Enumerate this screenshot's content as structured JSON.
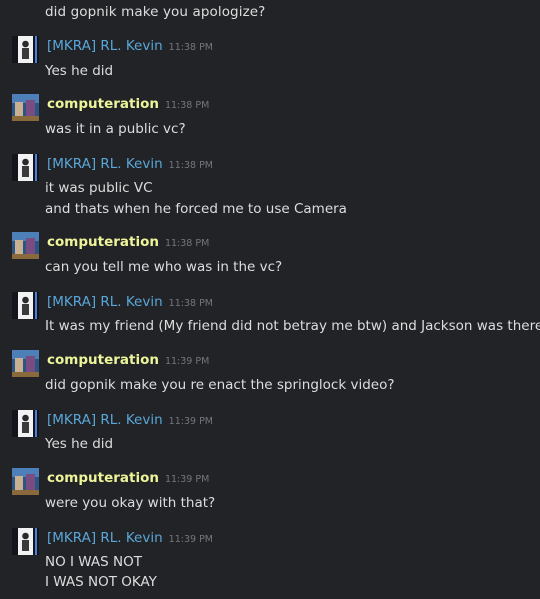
{
  "top_message": "did gopnik make you apologize?",
  "messages": [
    {
      "author": "[MKRA] RL. Kevin",
      "time": "11:38 PM",
      "lines": [
        "Yes he did"
      ]
    },
    {
      "author": "computeration",
      "time": "11:38 PM",
      "lines": [
        "was it in a public vc?"
      ]
    },
    {
      "author": "[MKRA] RL. Kevin",
      "time": "11:38 PM",
      "lines": [
        "it was public VC",
        "and thats when he forced me to use Camera"
      ]
    },
    {
      "author": "computeration",
      "time": "11:38 PM",
      "lines": [
        "can you tell me who was in the vc?"
      ]
    },
    {
      "author": "[MKRA] RL. Kevin",
      "time": "11:38 PM",
      "lines": [
        "It was my friend (My friend did not betray me btw) and Jackson was there to"
      ]
    },
    {
      "author": "computeration",
      "time": "11:39 PM",
      "lines": [
        "did gopnik make you re enact the springlock video?"
      ]
    },
    {
      "author": "[MKRA] RL. Kevin",
      "time": "11:39 PM",
      "lines": [
        "Yes he did"
      ]
    },
    {
      "author": "computeration",
      "time": "11:39 PM",
      "lines": [
        "were you okay with that?"
      ]
    },
    {
      "author": "[MKRA] RL. Kevin",
      "time": "11:39 PM",
      "lines": [
        "NO I WAS NOT",
        "I WAS NOT OKAY"
      ]
    }
  ],
  "colors": {
    "background": "#222326",
    "kevin_name": "#5aa6d8",
    "computeration_name": "#eef49a",
    "timestamp": "#72767d",
    "text": "#dcddde"
  }
}
